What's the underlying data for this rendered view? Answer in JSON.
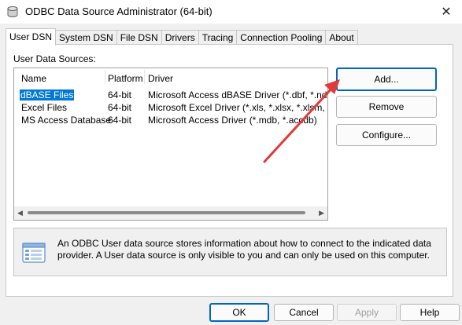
{
  "window": {
    "title": "ODBC Data Source Administrator (64-bit)",
    "close_glyph": "✕"
  },
  "tabs": [
    {
      "label": "User DSN",
      "active": true
    },
    {
      "label": "System DSN"
    },
    {
      "label": "File DSN"
    },
    {
      "label": "Drivers"
    },
    {
      "label": "Tracing"
    },
    {
      "label": "Connection Pooling"
    },
    {
      "label": "About"
    }
  ],
  "data_sources": {
    "label": "User Data Sources:",
    "columns": [
      "Name",
      "Platform",
      "Driver"
    ],
    "rows": [
      {
        "name": "dBASE Files",
        "platform": "64-bit",
        "driver": "Microsoft Access dBASE Driver (*.dbf, *.ndx, *.m",
        "selected": true
      },
      {
        "name": "Excel Files",
        "platform": "64-bit",
        "driver": "Microsoft Excel Driver (*.xls, *.xlsx, *.xlsm, *.xlsb)"
      },
      {
        "name": "MS Access Database",
        "platform": "64-bit",
        "driver": "Microsoft Access Driver (*.mdb, *.accdb)"
      }
    ]
  },
  "side_buttons": {
    "add": "Add...",
    "remove": "Remove",
    "configure": "Configure..."
  },
  "info": {
    "text": "An ODBC User data source stores information about how to connect to the indicated data provider.  A User data source is only visible to you and can only be used on this computer."
  },
  "footer_buttons": {
    "ok": "OK",
    "cancel": "Cancel",
    "apply": "Apply",
    "help": "Help"
  },
  "colors": {
    "selection": "#0078d7",
    "annotation_arrow": "#e03a3a",
    "default_button_border": "#0067c0"
  },
  "icons": {
    "app": "database-icon",
    "info": "data-source-icon"
  }
}
